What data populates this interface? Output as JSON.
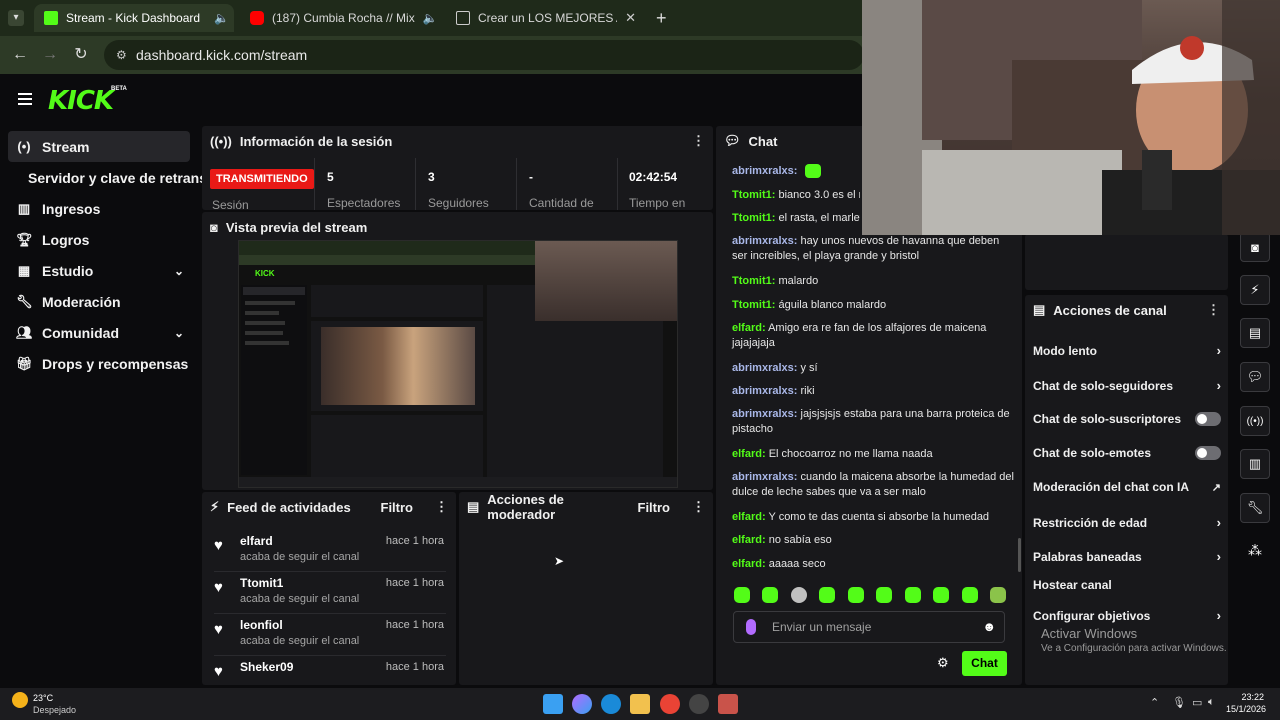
{
  "browser": {
    "tabs": [
      {
        "label": "Stream - Kick Dashboard",
        "color": "#53fc18"
      },
      {
        "label": "(187) Cumbia Rocha // Mix",
        "color": "#ff0000"
      },
      {
        "label": "Crear un LOS MEJORES ALFAJO",
        "color": "#2b2b2b"
      }
    ],
    "url": "dashboard.kick.com/stream"
  },
  "brand": {
    "logo": "KICK",
    "beta": "BETA",
    "accent": "#53fc18"
  },
  "sidebar": {
    "items": [
      {
        "label": "Stream",
        "icon": "broadcast-icon"
      },
      {
        "label": "Servidor y clave de retransm"
      },
      {
        "label": "Ingresos",
        "icon": "chart-icon"
      },
      {
        "label": "Logros",
        "icon": "trophy-icon"
      },
      {
        "label": "Estudio",
        "icon": "grid-icon"
      },
      {
        "label": "Moderación",
        "icon": "wrench-icon"
      },
      {
        "label": "Comunidad",
        "icon": "users-icon"
      },
      {
        "label": "Drops y recompensas",
        "icon": "gift-icon"
      }
    ]
  },
  "session": {
    "title": "Información de la sesión",
    "status": "TRANSMITIENDO",
    "stats": [
      {
        "value": "5",
        "label": "Espectadores"
      },
      {
        "value": "3",
        "label": "Seguidores"
      },
      {
        "value": "-",
        "label": "Cantidad de"
      },
      {
        "value": "02:42:54",
        "label": "Tiempo en"
      }
    ],
    "sublabel": "Sesión"
  },
  "preview": {
    "title": "Vista previa del stream"
  },
  "feed": {
    "title": "Feed de actividades",
    "filter": "Filtro",
    "items": [
      {
        "name": "elfard",
        "action": "acaba de seguir el canal",
        "time": "hace 1 hora"
      },
      {
        "name": "Ttomit1",
        "action": "acaba de seguir el canal",
        "time": "hace 1 hora"
      },
      {
        "name": "leonfiol",
        "action": "acaba de seguir el canal",
        "time": "hace 1 hora"
      },
      {
        "name": "Sheker09",
        "action": "acaba de seguir el canal",
        "time": "hace 1 hora"
      }
    ]
  },
  "mod_actions": {
    "title": "Acciones de moderador",
    "filter": "Filtro"
  },
  "chat": {
    "title": "Chat",
    "messages": [
      {
        "user": "abrimxralxs",
        "text": "",
        "c": "b"
      },
      {
        "user": "Ttomit1",
        "text": "bianco 3.0 es el m",
        "c": "g"
      },
      {
        "user": "Ttomit1",
        "text": "el rasta, el marley",
        "c": "g"
      },
      {
        "user": "abrimxralxs",
        "text": "hay unos nuevos de havanna que deben ser increibles, el playa grande y bristol",
        "c": "b"
      },
      {
        "user": "Ttomit1",
        "text": "malardo",
        "c": "g"
      },
      {
        "user": "Ttomit1",
        "text": "águila blanco malardo",
        "c": "g"
      },
      {
        "user": "elfard",
        "text": "Amigo era re fan de los alfajores de maicena jajajajaja",
        "c": "g"
      },
      {
        "user": "abrimxralxs",
        "text": "y sí",
        "c": "b"
      },
      {
        "user": "abrimxralxs",
        "text": "riki",
        "c": "b"
      },
      {
        "user": "abrimxralxs",
        "text": "jajsjsjsjs estaba para una barra proteica de pistacho",
        "c": "b"
      },
      {
        "user": "elfard",
        "text": "El chocoarroz no me llama naada",
        "c": "g"
      },
      {
        "user": "abrimxralxs",
        "text": "cuando la maicena absorbe la humedad del dulce de leche sabes que va a ser malo",
        "c": "b"
      },
      {
        "user": "elfard",
        "text": "Y como te das cuenta si absorbe la humedad",
        "c": "g"
      },
      {
        "user": "elfard",
        "text": "no sabía eso",
        "c": "g"
      },
      {
        "user": "elfard",
        "text": "aaaaa seco",
        "c": "g"
      }
    ],
    "input_placeholder": "Enviar un mensaje",
    "send_label": "Chat"
  },
  "channel_actions": {
    "title": "Acciones de canal",
    "items": [
      {
        "label": "Modo lento",
        "kind": "arrow"
      },
      {
        "label": "Chat de solo-seguidores",
        "kind": "arrow"
      },
      {
        "label": "Chat de solo-suscriptores",
        "kind": "toggle"
      },
      {
        "label": "Chat de solo-emotes",
        "kind": "toggle"
      },
      {
        "label": "Moderación del chat con IA",
        "kind": "external"
      },
      {
        "label": "Restricción de edad",
        "kind": "arrow"
      },
      {
        "label": "Palabras baneadas",
        "kind": "arrow"
      },
      {
        "label": "Hostear canal",
        "kind": "none"
      },
      {
        "label": "Configurar objetivos",
        "kind": "arrow"
      }
    ]
  },
  "watermark": {
    "line1": "Activar Windows",
    "line2": "Ve a Configuración para activar Windows."
  },
  "taskbar": {
    "temp": "23°C",
    "weather": "Despejado",
    "time": "23:22",
    "date": "15/1/2026"
  }
}
